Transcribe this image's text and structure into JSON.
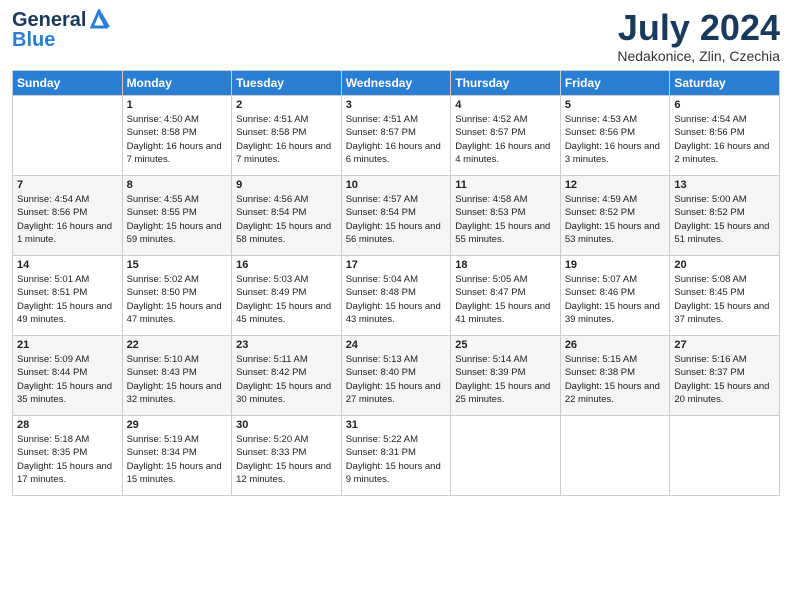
{
  "header": {
    "logo_line1": "General",
    "logo_line2": "Blue",
    "title": "July 2024",
    "location": "Nedakonice, Zlin, Czechia"
  },
  "weekdays": [
    "Sunday",
    "Monday",
    "Tuesday",
    "Wednesday",
    "Thursday",
    "Friday",
    "Saturday"
  ],
  "weeks": [
    [
      {
        "day": "",
        "sunrise": "",
        "sunset": "",
        "daylight": ""
      },
      {
        "day": "1",
        "sunrise": "Sunrise: 4:50 AM",
        "sunset": "Sunset: 8:58 PM",
        "daylight": "Daylight: 16 hours and 7 minutes."
      },
      {
        "day": "2",
        "sunrise": "Sunrise: 4:51 AM",
        "sunset": "Sunset: 8:58 PM",
        "daylight": "Daylight: 16 hours and 7 minutes."
      },
      {
        "day": "3",
        "sunrise": "Sunrise: 4:51 AM",
        "sunset": "Sunset: 8:57 PM",
        "daylight": "Daylight: 16 hours and 6 minutes."
      },
      {
        "day": "4",
        "sunrise": "Sunrise: 4:52 AM",
        "sunset": "Sunset: 8:57 PM",
        "daylight": "Daylight: 16 hours and 4 minutes."
      },
      {
        "day": "5",
        "sunrise": "Sunrise: 4:53 AM",
        "sunset": "Sunset: 8:56 PM",
        "daylight": "Daylight: 16 hours and 3 minutes."
      },
      {
        "day": "6",
        "sunrise": "Sunrise: 4:54 AM",
        "sunset": "Sunset: 8:56 PM",
        "daylight": "Daylight: 16 hours and 2 minutes."
      }
    ],
    [
      {
        "day": "7",
        "sunrise": "Sunrise: 4:54 AM",
        "sunset": "Sunset: 8:56 PM",
        "daylight": "Daylight: 16 hours and 1 minute."
      },
      {
        "day": "8",
        "sunrise": "Sunrise: 4:55 AM",
        "sunset": "Sunset: 8:55 PM",
        "daylight": "Daylight: 15 hours and 59 minutes."
      },
      {
        "day": "9",
        "sunrise": "Sunrise: 4:56 AM",
        "sunset": "Sunset: 8:54 PM",
        "daylight": "Daylight: 15 hours and 58 minutes."
      },
      {
        "day": "10",
        "sunrise": "Sunrise: 4:57 AM",
        "sunset": "Sunset: 8:54 PM",
        "daylight": "Daylight: 15 hours and 56 minutes."
      },
      {
        "day": "11",
        "sunrise": "Sunrise: 4:58 AM",
        "sunset": "Sunset: 8:53 PM",
        "daylight": "Daylight: 15 hours and 55 minutes."
      },
      {
        "day": "12",
        "sunrise": "Sunrise: 4:59 AM",
        "sunset": "Sunset: 8:52 PM",
        "daylight": "Daylight: 15 hours and 53 minutes."
      },
      {
        "day": "13",
        "sunrise": "Sunrise: 5:00 AM",
        "sunset": "Sunset: 8:52 PM",
        "daylight": "Daylight: 15 hours and 51 minutes."
      }
    ],
    [
      {
        "day": "14",
        "sunrise": "Sunrise: 5:01 AM",
        "sunset": "Sunset: 8:51 PM",
        "daylight": "Daylight: 15 hours and 49 minutes."
      },
      {
        "day": "15",
        "sunrise": "Sunrise: 5:02 AM",
        "sunset": "Sunset: 8:50 PM",
        "daylight": "Daylight: 15 hours and 47 minutes."
      },
      {
        "day": "16",
        "sunrise": "Sunrise: 5:03 AM",
        "sunset": "Sunset: 8:49 PM",
        "daylight": "Daylight: 15 hours and 45 minutes."
      },
      {
        "day": "17",
        "sunrise": "Sunrise: 5:04 AM",
        "sunset": "Sunset: 8:48 PM",
        "daylight": "Daylight: 15 hours and 43 minutes."
      },
      {
        "day": "18",
        "sunrise": "Sunrise: 5:05 AM",
        "sunset": "Sunset: 8:47 PM",
        "daylight": "Daylight: 15 hours and 41 minutes."
      },
      {
        "day": "19",
        "sunrise": "Sunrise: 5:07 AM",
        "sunset": "Sunset: 8:46 PM",
        "daylight": "Daylight: 15 hours and 39 minutes."
      },
      {
        "day": "20",
        "sunrise": "Sunrise: 5:08 AM",
        "sunset": "Sunset: 8:45 PM",
        "daylight": "Daylight: 15 hours and 37 minutes."
      }
    ],
    [
      {
        "day": "21",
        "sunrise": "Sunrise: 5:09 AM",
        "sunset": "Sunset: 8:44 PM",
        "daylight": "Daylight: 15 hours and 35 minutes."
      },
      {
        "day": "22",
        "sunrise": "Sunrise: 5:10 AM",
        "sunset": "Sunset: 8:43 PM",
        "daylight": "Daylight: 15 hours and 32 minutes."
      },
      {
        "day": "23",
        "sunrise": "Sunrise: 5:11 AM",
        "sunset": "Sunset: 8:42 PM",
        "daylight": "Daylight: 15 hours and 30 minutes."
      },
      {
        "day": "24",
        "sunrise": "Sunrise: 5:13 AM",
        "sunset": "Sunset: 8:40 PM",
        "daylight": "Daylight: 15 hours and 27 minutes."
      },
      {
        "day": "25",
        "sunrise": "Sunrise: 5:14 AM",
        "sunset": "Sunset: 8:39 PM",
        "daylight": "Daylight: 15 hours and 25 minutes."
      },
      {
        "day": "26",
        "sunrise": "Sunrise: 5:15 AM",
        "sunset": "Sunset: 8:38 PM",
        "daylight": "Daylight: 15 hours and 22 minutes."
      },
      {
        "day": "27",
        "sunrise": "Sunrise: 5:16 AM",
        "sunset": "Sunset: 8:37 PM",
        "daylight": "Daylight: 15 hours and 20 minutes."
      }
    ],
    [
      {
        "day": "28",
        "sunrise": "Sunrise: 5:18 AM",
        "sunset": "Sunset: 8:35 PM",
        "daylight": "Daylight: 15 hours and 17 minutes."
      },
      {
        "day": "29",
        "sunrise": "Sunrise: 5:19 AM",
        "sunset": "Sunset: 8:34 PM",
        "daylight": "Daylight: 15 hours and 15 minutes."
      },
      {
        "day": "30",
        "sunrise": "Sunrise: 5:20 AM",
        "sunset": "Sunset: 8:33 PM",
        "daylight": "Daylight: 15 hours and 12 minutes."
      },
      {
        "day": "31",
        "sunrise": "Sunrise: 5:22 AM",
        "sunset": "Sunset: 8:31 PM",
        "daylight": "Daylight: 15 hours and 9 minutes."
      },
      {
        "day": "",
        "sunrise": "",
        "sunset": "",
        "daylight": ""
      },
      {
        "day": "",
        "sunrise": "",
        "sunset": "",
        "daylight": ""
      },
      {
        "day": "",
        "sunrise": "",
        "sunset": "",
        "daylight": ""
      }
    ]
  ]
}
